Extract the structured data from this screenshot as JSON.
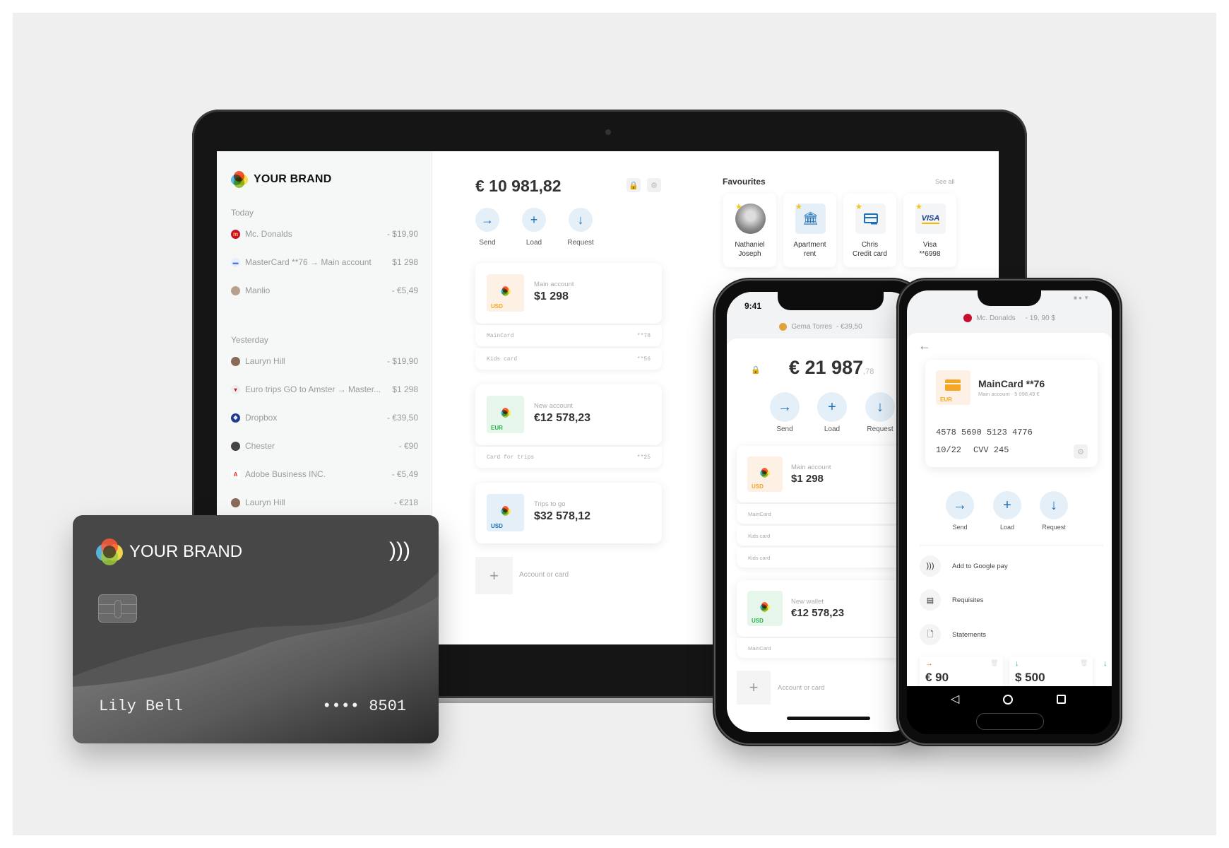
{
  "brand": {
    "name": "YOUR BRAND"
  },
  "laptop": {
    "sidebar": {
      "sections": [
        {
          "label": "Today",
          "items": [
            {
              "name": "Mc. Donalds",
              "amount": "- $19,90",
              "icon": "mcdonalds-icon"
            },
            {
              "name": "MasterCard **76 → Main account",
              "amount": "$1 298",
              "icon": "card-icon"
            },
            {
              "name": "Manlio",
              "amount": "- €5,49",
              "icon": "avatar"
            }
          ]
        },
        {
          "label": "Yesterday",
          "items": [
            {
              "name": "Lauryn Hill",
              "amount": "- $19,90",
              "icon": "avatar"
            },
            {
              "name": "Euro trips GO to Amster → Master...",
              "amount": "$1 298",
              "icon": "flag-icon"
            },
            {
              "name": "Dropbox",
              "amount": "- €39,50",
              "icon": "dropbox-icon"
            },
            {
              "name": "Chester",
              "amount": "- €90",
              "icon": "avatar"
            },
            {
              "name": "Adobe Business INC.",
              "amount": "- €5,49",
              "icon": "adobe-icon"
            },
            {
              "name": "Lauryn Hill",
              "amount": "- €218",
              "icon": "avatar"
            }
          ]
        }
      ]
    },
    "balance": "€ 10 981,82",
    "actions": [
      {
        "label": "Send",
        "icon": "arrow-right-icon"
      },
      {
        "label": "Load",
        "icon": "plus-icon"
      },
      {
        "label": "Request",
        "icon": "arrow-down-icon"
      }
    ],
    "accounts": [
      {
        "name": "Main account",
        "value": "$1 298",
        "currency": "USD",
        "cards": [
          {
            "name": "MainCard",
            "suffix": "**78"
          },
          {
            "name": "Kids card",
            "suffix": "**56"
          }
        ]
      },
      {
        "name": "New account",
        "value": "€12 578,23",
        "currency": "EUR",
        "cards": [
          {
            "name": "Card for trips",
            "suffix": "**25"
          }
        ]
      },
      {
        "name": "Trips to go",
        "value": "$32 578,12",
        "currency": "USD",
        "cards": []
      }
    ],
    "add_label": "Account or card",
    "favourites": {
      "title": "Favourites",
      "see_all": "See all",
      "items": [
        {
          "label": "Nathaniel\nJoseph",
          "icon": "avatar"
        },
        {
          "label": "Apartment\nrent",
          "icon": "bank-icon"
        },
        {
          "label": "Chris\nCredit card",
          "icon": "credit-card-icon"
        },
        {
          "label": "Visa\n**6998",
          "icon": "visa-icon",
          "logo_text": "VISA"
        }
      ]
    }
  },
  "physical_card": {
    "holder": "Lily Bell",
    "masked": "•••• ",
    "last4": "8501"
  },
  "iphone": {
    "time": "9:41",
    "notification": {
      "name": "Gema Torres",
      "amount": "- €39,50"
    },
    "balance_main": "€ 21 987",
    "balance_cents": ",78",
    "actions": [
      "Send",
      "Load",
      "Request"
    ],
    "accounts": [
      {
        "name": "Main account",
        "value": "$1 298",
        "currency": "USD",
        "cards": [
          "MainCard",
          "Kids card",
          "Kids card"
        ]
      },
      {
        "name": "New wallet",
        "value": "€12 578,23",
        "currency": "USD",
        "cards": [
          "MainCard"
        ]
      }
    ],
    "add_label": "Account or card"
  },
  "android": {
    "notification": {
      "name": "Mc. Donalds",
      "amount": "- 19, 90 $"
    },
    "card": {
      "title": "MainCard **76",
      "subtitle": "Main account · 5 098,49 €",
      "currency": "EUR",
      "number": "4578 5690 5123 4776",
      "expiry": "10/22",
      "cvv": "CVV 245"
    },
    "actions": [
      "Send",
      "Load",
      "Request"
    ],
    "options": [
      {
        "label": "Add to Google pay",
        "icon": "nfc-icon"
      },
      {
        "label": "Requisites",
        "icon": "document-icon"
      },
      {
        "label": "Statements",
        "icon": "file-icon"
      }
    ],
    "transactions": [
      {
        "amount": "€ 90",
        "direction": "out"
      },
      {
        "amount": "$ 500",
        "direction": "in"
      }
    ]
  },
  "colors": {
    "accent": "#1b6fb8",
    "action_bg": "#e4eff8",
    "usd_bg": "#fdf0e4",
    "usd_fg": "#f5a623",
    "eur_green_bg": "#e6f6ea",
    "eur_green_fg": "#27b14a",
    "usd_blue_bg": "#e4eff8",
    "usd_blue_fg": "#1b6fb8"
  }
}
